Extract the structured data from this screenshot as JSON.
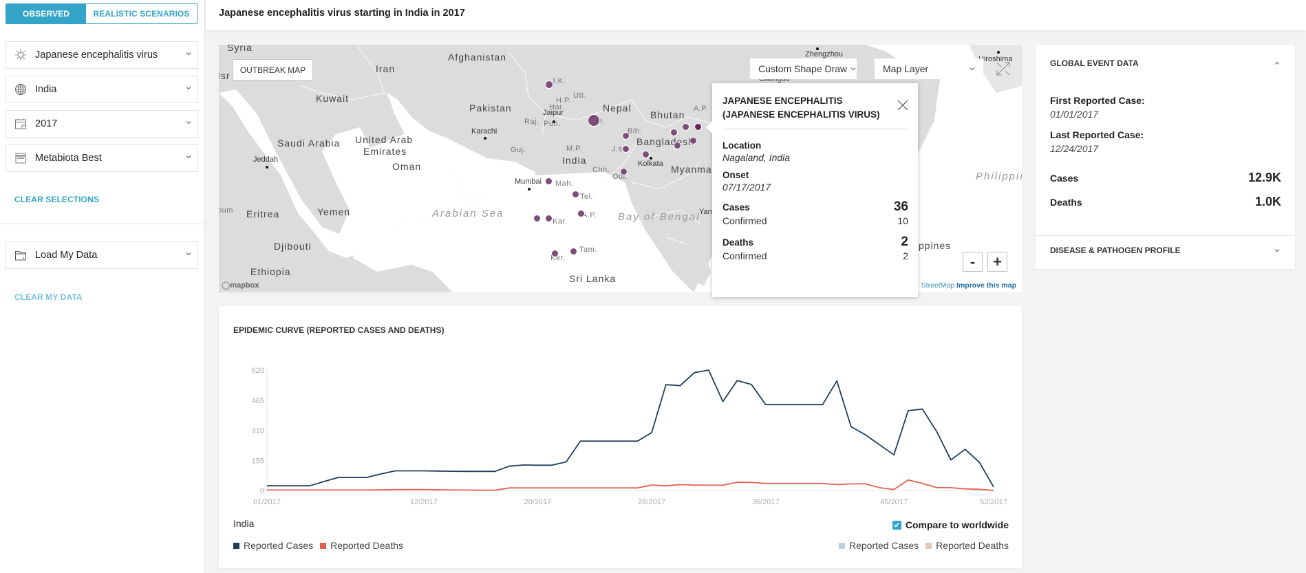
{
  "sidebar": {
    "mode_toggle": {
      "observed": "OBSERVED",
      "scenarios": "REALISTIC SCENARIOS",
      "active": "observed"
    },
    "selects": [
      {
        "icon": "virus-icon",
        "value": "Japanese encephalitis virus"
      },
      {
        "icon": "globe-icon",
        "value": "India"
      },
      {
        "icon": "calendar-icon",
        "value": "2017"
      },
      {
        "icon": "database-icon",
        "value": "Metabiota Best"
      }
    ],
    "clear_selections": "CLEAR SELECTIONS",
    "load_data": {
      "icon": "folder-icon",
      "value": "Load My Data"
    },
    "clear_my_data": "CLEAR MY DATA"
  },
  "header": {
    "title": "Japanese encephalitis virus starting in India in 2017"
  },
  "map": {
    "outbreak_map_button": "OUTBREAK MAP",
    "custom_shape_draw": "Custom Shape Draw",
    "map_layer": "Map Layer",
    "zoom_out": "-",
    "zoom_in": "+",
    "attribution_prefix": "StreetMap",
    "improve_link": "Improve this map",
    "mapbox_logo": "mapbox",
    "labels": {
      "countries": [
        "Syria",
        "Isr",
        "Iran",
        "Afghanistan",
        "Kuwait",
        "Pakistan",
        "Nepal",
        "Bhutan",
        "Saudi Arabia",
        "United Arab",
        "Emirates",
        "Oman",
        "India",
        "Bangladesh",
        "Myanmar",
        "Eritrea",
        "Yemen",
        "Djibouti",
        "Ethiopia",
        "Sri Lanka",
        "ppines",
        "oum"
      ],
      "seas": [
        "Arabian Sea",
        "Bay of Bengal",
        "Philippine Sea"
      ],
      "regions": [
        "J.K.",
        "H.P.",
        "Pun.",
        "Utt.",
        "Har.",
        "Raj.",
        "U.P.",
        "Bih.",
        "Guj.",
        "M.P.",
        "J.s.",
        "Chh.",
        "Odi.",
        "Mah.",
        "Tel.",
        "A.P.",
        "Kar.",
        "Tam.",
        "Ker.",
        "A.P."
      ],
      "cities": [
        "Jaipur",
        "Karachi",
        "Jeddah",
        "Mumbai",
        "Kolkata",
        "Zhengzhou",
        "Chengdu",
        "Hiroshima",
        "Yan"
      ]
    }
  },
  "popup": {
    "title": "JAPANESE ENCEPHALITIS (JAPANESE ENCEPHALITIS VIRUS)",
    "location_label": "Location",
    "location": "Nagaland, India",
    "onset_label": "Onset",
    "onset": "07/17/2017",
    "cases_label": "Cases",
    "cases": "36",
    "cases_confirmed_label": "Confirmed",
    "cases_confirmed": "10",
    "deaths_label": "Deaths",
    "deaths": "2",
    "deaths_confirmed_label": "Confirmed",
    "deaths_confirmed": "2"
  },
  "global_event": {
    "heading": "GLOBAL EVENT DATA",
    "first_label": "First Reported Case:",
    "first_date": "01/01/2017",
    "last_label": "Last Reported Case:",
    "last_date": "12/24/2017",
    "cases_label": "Cases",
    "cases": "12.9K",
    "deaths_label": "Deaths",
    "deaths": "1.0K",
    "profile_heading": "DISEASE & PATHOGEN PROFILE"
  },
  "epi_curve": {
    "country": "India",
    "compare_label": "Compare to worldwide",
    "compare_checked": true,
    "legend_local": [
      "Reported Cases",
      "Reported Deaths"
    ],
    "legend_world": [
      "Reported Cases",
      "Reported Deaths"
    ]
  },
  "colors": {
    "accent": "#34a4c9",
    "cases": "#1d3d5c",
    "deaths": "#e0604f",
    "world_cases": "#bcd0e3",
    "world_deaths": "#e0c8c0",
    "outbreak_dot": "#7d4c78"
  },
  "chart_data": {
    "type": "line",
    "title": "EPIDEMIC CURVE (REPORTED CASES AND DEATHS)",
    "xlabel": "",
    "ylabel": "",
    "ylim": [
      0,
      620
    ],
    "yticks": [
      0,
      155,
      310,
      465,
      620
    ],
    "x": [
      1,
      2,
      3,
      4,
      5,
      6,
      7,
      8,
      9,
      10,
      11,
      12,
      13,
      14,
      15,
      16,
      17,
      18,
      19,
      20,
      21,
      22,
      23,
      24,
      25,
      26,
      27,
      28,
      29,
      30,
      31,
      32,
      33,
      34,
      35,
      36,
      37,
      38,
      39,
      40,
      41,
      42,
      43,
      44,
      45,
      46,
      47,
      48,
      49,
      50,
      51,
      52
    ],
    "xticks": [
      {
        "week": 1,
        "label": "01/2017"
      },
      {
        "week": 12,
        "label": "12/2017"
      },
      {
        "week": 20,
        "label": "20/2017"
      },
      {
        "week": 28,
        "label": "28/2017"
      },
      {
        "week": 36,
        "label": "36/2017"
      },
      {
        "week": 45,
        "label": "45/2017"
      },
      {
        "week": 52,
        "label": "52/2017"
      }
    ],
    "series": [
      {
        "name": "Reported Cases",
        "color": "#1d3d5c",
        "values": [
          24,
          24,
          24,
          24,
          46,
          67,
          67,
          67,
          85,
          101,
          101,
          101,
          100,
          99,
          98,
          98,
          98,
          125,
          131,
          130,
          130,
          147,
          254,
          254,
          254,
          254,
          254,
          298,
          545,
          540,
          607,
          620,
          458,
          566,
          546,
          442,
          442,
          442,
          442,
          442,
          564,
          328,
          287,
          235,
          183,
          411,
          419,
          304,
          157,
          212,
          145,
          18
        ]
      },
      {
        "name": "Reported Deaths",
        "color": "#e0604f",
        "values": [
          2,
          2,
          2,
          2,
          2,
          2,
          2,
          2,
          3,
          5,
          5,
          5,
          4,
          2,
          2,
          1,
          1,
          13,
          13,
          13,
          13,
          13,
          13,
          13,
          13,
          13,
          13,
          28,
          24,
          30,
          28,
          27,
          27,
          42,
          41,
          36,
          36,
          36,
          36,
          36,
          30,
          34,
          34,
          14,
          5,
          54,
          36,
          15,
          14,
          8,
          6,
          0
        ]
      }
    ],
    "grid": false,
    "legend": "bottom-left"
  }
}
